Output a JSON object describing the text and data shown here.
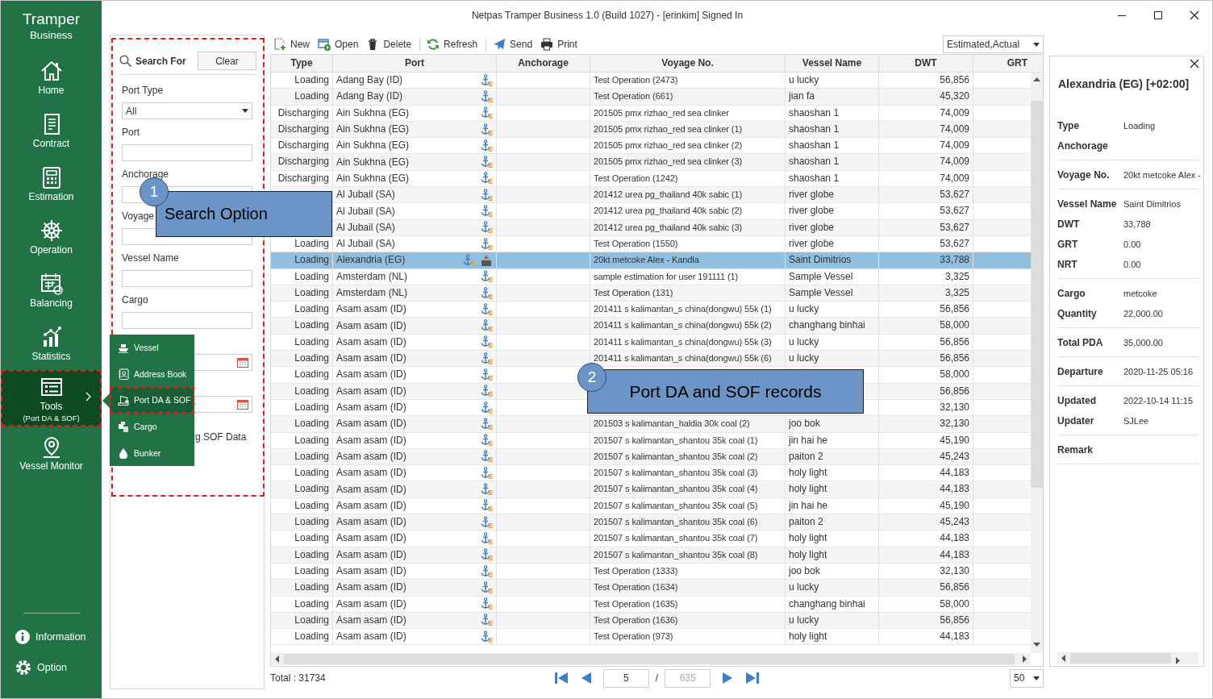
{
  "window": {
    "title": "Netpas Tramper Business 1.0 (Build 1027) - [erinkim] Signed In"
  },
  "sidebar": {
    "logo": [
      "Tramper",
      "Business"
    ],
    "items": [
      {
        "label": "Home",
        "selected": false,
        "highlighted": false
      },
      {
        "label": "Contract",
        "selected": false,
        "highlighted": false
      },
      {
        "label": "Estimation",
        "selected": false,
        "highlighted": false
      },
      {
        "label": "Operation",
        "selected": false,
        "highlighted": false
      },
      {
        "label": "Balancing",
        "selected": false,
        "highlighted": false
      },
      {
        "label": "Statistics",
        "selected": false,
        "highlighted": false
      },
      {
        "label": "Tools",
        "sublabel": "(Port DA & SOF)",
        "selected": true,
        "highlighted": true,
        "has_submenu": true
      },
      {
        "label": "Vessel Monitor",
        "selected": false,
        "highlighted": false
      }
    ],
    "footer": [
      {
        "label": "Information"
      },
      {
        "label": "Option"
      }
    ]
  },
  "flyout_menu": {
    "items": [
      {
        "label": "Vessel",
        "selected": false,
        "highlighted": false
      },
      {
        "label": "Address Book",
        "selected": false,
        "highlighted": false
      },
      {
        "label": "Port DA & SOF",
        "selected": true,
        "highlighted": true
      },
      {
        "label": "Cargo",
        "selected": false,
        "highlighted": false
      },
      {
        "label": "Bunker",
        "selected": false,
        "highlighted": false
      }
    ]
  },
  "search": {
    "title": "Search For",
    "clear": "Clear",
    "highlighted": true,
    "fields": [
      {
        "kind": "select",
        "label": "Port Type",
        "value": "All"
      },
      {
        "kind": "text",
        "label": "Port"
      },
      {
        "kind": "text",
        "label": "Anchorage"
      },
      {
        "kind": "text",
        "label": "Voyage"
      },
      {
        "kind": "text",
        "label": "Vessel Name"
      },
      {
        "kind": "text",
        "label": "Cargo"
      },
      {
        "kind": "date"
      },
      {
        "kind": "date"
      },
      {
        "kind": "note",
        "text": "g SOF Data"
      }
    ]
  },
  "toolbar": {
    "groups": [
      [
        {
          "label": "New"
        },
        {
          "label": "Open"
        },
        {
          "label": "Delete"
        }
      ],
      [
        {
          "label": "Refresh"
        }
      ],
      [
        {
          "label": "Send"
        },
        {
          "label": "Print"
        }
      ]
    ],
    "filter": "Estimated,Actual"
  },
  "table": {
    "columns": [
      "Type",
      "Port",
      "Anchorage",
      "Voyage No.",
      "Vessel Name",
      "DWT",
      "GRT"
    ],
    "rows": [
      {
        "type": "Loading",
        "port": "Adang Bay (ID)",
        "voyage": "Test Operation (2473)",
        "vessel": "u lucky",
        "dwt": "56,856",
        "has_sof": false,
        "selected": false
      },
      {
        "type": "Loading",
        "port": "Adang Bay (ID)",
        "voyage": "Test Operation (661)",
        "vessel": "jian fa",
        "dwt": "45,320",
        "has_sof": false,
        "selected": false
      },
      {
        "type": "Discharging",
        "port": "Ain Sukhna (EG)",
        "voyage": "201505 pmx rizhao_red sea clinker",
        "vessel": "shaoshan 1",
        "dwt": "74,009",
        "has_sof": false,
        "selected": false
      },
      {
        "type": "Discharging",
        "port": "Ain Sukhna (EG)",
        "voyage": "201505 pmx rizhao_red sea clinker (1)",
        "vessel": "shaoshan 1",
        "dwt": "74,009",
        "has_sof": false,
        "selected": false
      },
      {
        "type": "Discharging",
        "port": "Ain Sukhna (EG)",
        "voyage": "201505 pmx rizhao_red sea clinker (2)",
        "vessel": "shaoshan 1",
        "dwt": "74,009",
        "has_sof": false,
        "selected": false
      },
      {
        "type": "Discharging",
        "port": "Ain Sukhna (EG)",
        "voyage": "201505 pmx rizhao_red sea clinker (3)",
        "vessel": "shaoshan 1",
        "dwt": "74,009",
        "has_sof": false,
        "selected": false
      },
      {
        "type": "Discharging",
        "port": "Ain Sukhna (EG)",
        "voyage": "Test Operation (1242)",
        "vessel": "shaoshan 1",
        "dwt": "74,009",
        "has_sof": false,
        "selected": false
      },
      {
        "port": "Al Jubail (SA)",
        "voyage": "201412 urea pg_thailand 40k sabic (1)",
        "vessel": "river globe",
        "dwt": "53,627",
        "has_sof": false,
        "selected": false
      },
      {
        "port": "Al Jubail (SA)",
        "voyage": "201412 urea pg_thailand 40k sabic (2)",
        "vessel": "river globe",
        "dwt": "53,627",
        "has_sof": false,
        "selected": false
      },
      {
        "port": "Al Jubail (SA)",
        "voyage": "201412 urea pg_thailand 40k sabic (3)",
        "vessel": "river globe",
        "dwt": "53,627",
        "has_sof": false,
        "selected": false
      },
      {
        "type": "Loading",
        "port": "Al Jubail (SA)",
        "voyage": "Test Operation (1550)",
        "vessel": "river globe",
        "dwt": "53,627",
        "has_sof": false,
        "selected": false
      },
      {
        "type": "Loading",
        "port": "Alexandria (EG)",
        "voyage": "20kt metcoke Alex - Kandla",
        "vessel": "Saint Dimitrios",
        "dwt": "33,788",
        "has_sof": true,
        "selected": true
      },
      {
        "type": "Loading",
        "port": "Amsterdam (NL)",
        "voyage": "sample estimation for user 191111 (1)",
        "vessel": "Sample Vessel",
        "dwt": "3,325",
        "has_sof": false,
        "selected": false
      },
      {
        "type": "Loading",
        "port": "Amsterdam (NL)",
        "voyage": "Test Operation (131)",
        "vessel": "Sample Vessel",
        "dwt": "3,325",
        "has_sof": false,
        "selected": false
      },
      {
        "type": "Loading",
        "port": "Asam asam (ID)",
        "voyage": "201411 s kalimantan_s china(dongwu) 55k (1)",
        "vessel": "u lucky",
        "dwt": "56,856",
        "has_sof": false,
        "selected": false
      },
      {
        "type": "Loading",
        "port": "Asam asam (ID)",
        "voyage": "201411 s kalimantan_s china(dongwu) 55k (2)",
        "vessel": "changhang binhai",
        "dwt": "58,000",
        "has_sof": false,
        "selected": false
      },
      {
        "type": "Loading",
        "port": "Asam asam (ID)",
        "voyage": "201411 s kalimantan_s china(dongwu) 55k (3)",
        "vessel": "u lucky",
        "dwt": "56,856",
        "has_sof": false,
        "selected": false
      },
      {
        "type": "Loading",
        "port": "Asam asam (ID)",
        "voyage": "201411 s kalimantan_s china(dongwu) 55k (6)",
        "vessel": "u lucky",
        "dwt": "56,856",
        "has_sof": false,
        "selected": false
      },
      {
        "type": "Loading",
        "port": "Asam asam (ID)",
        "dwt": "58,000",
        "has_sof": false,
        "selected": false
      },
      {
        "type": "Loading",
        "port": "Asam asam (ID)",
        "dwt": "56,856",
        "has_sof": false,
        "selected": false
      },
      {
        "type": "Loading",
        "port": "Asam asam (ID)",
        "dwt": "32,130",
        "has_sof": false,
        "selected": false
      },
      {
        "type": "Loading",
        "port": "Asam asam (ID)",
        "voyage": "201503 s kalimantan_haldia 30k coal (2)",
        "vessel": "joo bok",
        "dwt": "32,130",
        "has_sof": false,
        "selected": false
      },
      {
        "type": "Loading",
        "port": "Asam asam (ID)",
        "voyage": "201507 s kalimantan_shantou 35k coal (1)",
        "vessel": "jin hai he",
        "dwt": "45,190",
        "has_sof": false,
        "selected": false
      },
      {
        "type": "Loading",
        "port": "Asam asam (ID)",
        "voyage": "201507 s kalimantan_shantou 35k coal (2)",
        "vessel": "paiton 2",
        "dwt": "45,243",
        "has_sof": false,
        "selected": false
      },
      {
        "type": "Loading",
        "port": "Asam asam (ID)",
        "voyage": "201507 s kalimantan_shantou 35k coal (3)",
        "vessel": "holy light",
        "dwt": "44,183",
        "has_sof": false,
        "selected": false
      },
      {
        "type": "Loading",
        "port": "Asam asam (ID)",
        "voyage": "201507 s kalimantan_shantou 35k coal (4)",
        "vessel": "holy light",
        "dwt": "44,183",
        "has_sof": false,
        "selected": false
      },
      {
        "type": "Loading",
        "port": "Asam asam (ID)",
        "voyage": "201507 s kalimantan_shantou 35k coal (5)",
        "vessel": "jin hai he",
        "dwt": "45,190",
        "has_sof": false,
        "selected": false
      },
      {
        "type": "Loading",
        "port": "Asam asam (ID)",
        "voyage": "201507 s kalimantan_shantou 35k coal (6)",
        "vessel": "paiton 2",
        "dwt": "45,243",
        "has_sof": false,
        "selected": false
      },
      {
        "type": "Loading",
        "port": "Asam asam (ID)",
        "voyage": "201507 s kalimantan_shantou 35k coal (7)",
        "vessel": "holy light",
        "dwt": "44,183",
        "has_sof": false,
        "selected": false
      },
      {
        "type": "Loading",
        "port": "Asam asam (ID)",
        "voyage": "201507 s kalimantan_shantou 35k coal (8)",
        "vessel": "holy light",
        "dwt": "44,183",
        "has_sof": false,
        "selected": false
      },
      {
        "type": "Loading",
        "port": "Asam asam (ID)",
        "voyage": "Test Operation (1333)",
        "vessel": "joo bok",
        "dwt": "32,130",
        "has_sof": false,
        "selected": false
      },
      {
        "type": "Loading",
        "port": "Asam asam (ID)",
        "voyage": "Test Operation (1634)",
        "vessel": "u lucky",
        "dwt": "56,856",
        "has_sof": false,
        "selected": false
      },
      {
        "type": "Loading",
        "port": "Asam asam (ID)",
        "voyage": "Test Operation (1635)",
        "vessel": "changhang binhai",
        "dwt": "58,000",
        "has_sof": false,
        "selected": false
      },
      {
        "type": "Loading",
        "port": "Asam asam (ID)",
        "voyage": "Test Operation (1636)",
        "vessel": "u lucky",
        "dwt": "56,856",
        "has_sof": false,
        "selected": false
      },
      {
        "type": "Loading",
        "port": "Asam asam (ID)",
        "voyage": "Test Operation (973)",
        "vessel": "holy light",
        "dwt": "44,183",
        "has_sof": false,
        "selected": false
      }
    ]
  },
  "pager": {
    "total": "Total : 31734",
    "page": "5",
    "separator": "/",
    "pages": "635",
    "page_size": "50"
  },
  "detail": {
    "title": "Alexandria (EG) [+02:00]",
    "groups": [
      [
        {
          "label": "Type",
          "value": "Loading"
        },
        {
          "label": "Anchorage"
        }
      ],
      [
        {
          "label": "Voyage No.",
          "value": "20kt metcoke Alex -"
        }
      ],
      [
        {
          "label": "Vessel Name",
          "value": "Saint Dimitrios"
        },
        {
          "label": "DWT",
          "value": "33,788"
        },
        {
          "label": "GRT",
          "value": "0.00"
        },
        {
          "label": "NRT",
          "value": "0.00"
        }
      ],
      [
        {
          "label": "Cargo",
          "value": "metcoke"
        },
        {
          "label": "Quantity",
          "value": "22,000.00"
        }
      ],
      [
        {
          "label": "Total PDA",
          "value": "35,000.00"
        }
      ],
      [
        {
          "label": "Departure",
          "value": "2020-11-25 05:16"
        }
      ],
      [
        {
          "label": "Updated",
          "value": "2022-10-14 11:15"
        },
        {
          "label": "Updater",
          "value": "SJLee"
        }
      ],
      [
        {
          "label": "Remark"
        }
      ]
    ]
  },
  "callouts": [
    {
      "number": "1",
      "text": "Search Option"
    },
    {
      "number": "2",
      "text": "Port DA and SOF records"
    }
  ]
}
